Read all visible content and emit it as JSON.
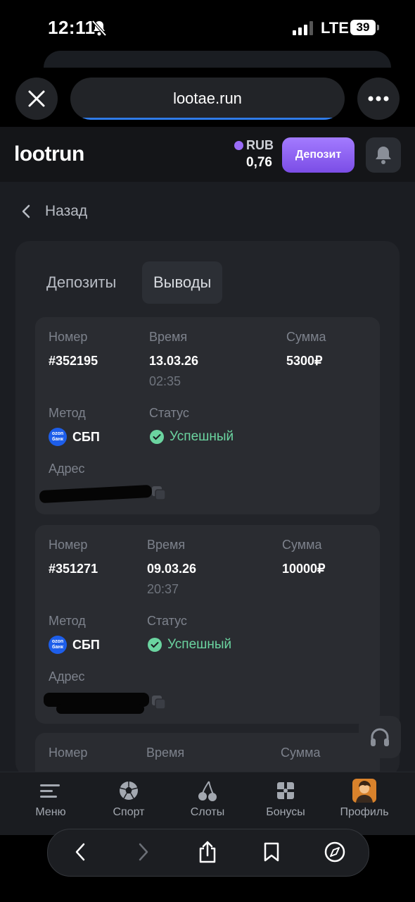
{
  "status_bar": {
    "time": "12:11",
    "network": "LTE",
    "battery": "39"
  },
  "browser": {
    "url": "lootae.run"
  },
  "header": {
    "logo": "lootrun",
    "currency": "RUB",
    "balance": "0,76",
    "deposit_label": "Депозит"
  },
  "back_label": "Назад",
  "tabs": [
    {
      "label": "Депозиты",
      "active": false
    },
    {
      "label": "Выводы",
      "active": true
    }
  ],
  "labels": {
    "number": "Номер",
    "time": "Время",
    "amount": "Сумма",
    "method": "Метод",
    "status": "Статус",
    "address": "Адрес"
  },
  "transactions": [
    {
      "number": "#352195",
      "date": "13.03.26",
      "time": "02:35",
      "amount": "5300₽",
      "method": "СБП",
      "bank_logo": "ozon банк",
      "status": "Успешный"
    },
    {
      "number": "#351271",
      "date": "09.03.26",
      "time": "20:37",
      "amount": "10000₽",
      "method": "СБП",
      "bank_logo": "ozon банк",
      "status": "Успешный"
    }
  ],
  "nav": [
    {
      "label": "Меню",
      "icon": "menu-icon"
    },
    {
      "label": "Спорт",
      "icon": "soccer-ball-icon"
    },
    {
      "label": "Слоты",
      "icon": "cherries-icon"
    },
    {
      "label": "Бонусы",
      "icon": "gift-icon"
    },
    {
      "label": "Профиль",
      "icon": "avatar"
    }
  ],
  "colors": {
    "accent": "#8b5cf6",
    "success": "#6bd4a0",
    "background": "#1b1d22"
  }
}
